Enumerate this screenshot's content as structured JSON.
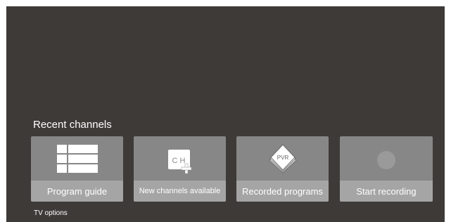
{
  "recent": {
    "title": "Recent channels",
    "cards": [
      {
        "label": "Program guide",
        "icon": "program-guide-grid-icon"
      },
      {
        "label": "New channels available",
        "icon": "channel-add-icon",
        "icon_text": "C H"
      },
      {
        "label": "Recorded programs",
        "icon": "pvr-recordings-icon",
        "icon_text": "PVR"
      },
      {
        "label": "Start recording",
        "icon": "record-dot-icon"
      }
    ]
  },
  "footer": {
    "label": "TV options"
  },
  "colors": {
    "background": "#3d3a38",
    "card": "#878787",
    "card_label_bar": "#a5a5a5",
    "text": "#ffffff"
  }
}
